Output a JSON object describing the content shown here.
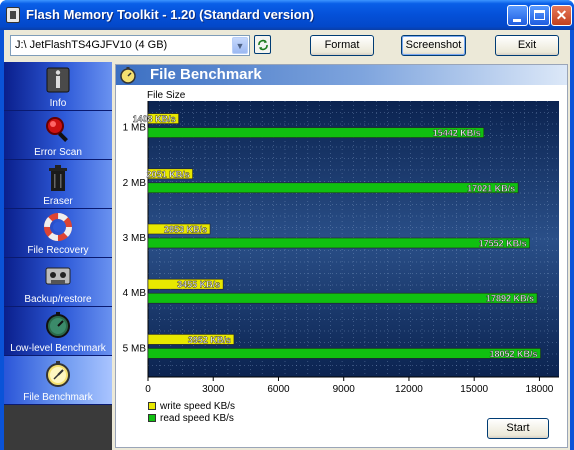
{
  "window": {
    "title": "Flash Memory Toolkit - 1.20 (Standard version)"
  },
  "toolbar": {
    "drive_value": "J:\\ JetFlashTS4GJFV10 (4 GB)",
    "format_label": "Format",
    "screenshot_label": "Screenshot",
    "exit_label": "Exit"
  },
  "sidebar": {
    "items": [
      {
        "label": "Info",
        "icon": "info-icon"
      },
      {
        "label": "Error Scan",
        "icon": "magnifier-icon"
      },
      {
        "label": "Eraser",
        "icon": "trash-icon"
      },
      {
        "label": "File Recovery",
        "icon": "lifebuoy-icon"
      },
      {
        "label": "Backup/restore",
        "icon": "cassette-icon"
      },
      {
        "label": "Low-level Benchmark",
        "icon": "stopwatch-icon"
      },
      {
        "label": "File Benchmark",
        "icon": "stopwatch-icon"
      }
    ],
    "selected": "File Benchmark"
  },
  "panel": {
    "title": "File Benchmark",
    "start_label": "Start"
  },
  "chart_data": {
    "type": "bar",
    "orientation": "horizontal",
    "ylabel": "File Size",
    "categories": [
      "1 MB",
      "2 MB",
      "3 MB",
      "4 MB",
      "5 MB"
    ],
    "series": [
      {
        "name": "write speed KB/s",
        "color": "#e8e800",
        "values": [
          1408,
          2051,
          2853,
          3455,
          3952
        ],
        "labels": [
          "1408 KB/s",
          "2051 KB/s",
          "2853 KB/s",
          "3455 KB/s",
          "3952 KB/s"
        ]
      },
      {
        "name": "read speed KB/s",
        "color": "#10c010",
        "values": [
          15442,
          17021,
          17552,
          17892,
          18052
        ],
        "labels": [
          "15442 KB/s",
          "17021 KB/s",
          "17552 KB/s",
          "17892 KB/s",
          "18052 KB/s"
        ]
      }
    ],
    "xlim": [
      0,
      18900
    ],
    "xticks": [
      "0",
      "3000",
      "6000",
      "9000",
      "12000",
      "15000",
      "18000"
    ],
    "grid": true,
    "legend": "bottom-left"
  }
}
